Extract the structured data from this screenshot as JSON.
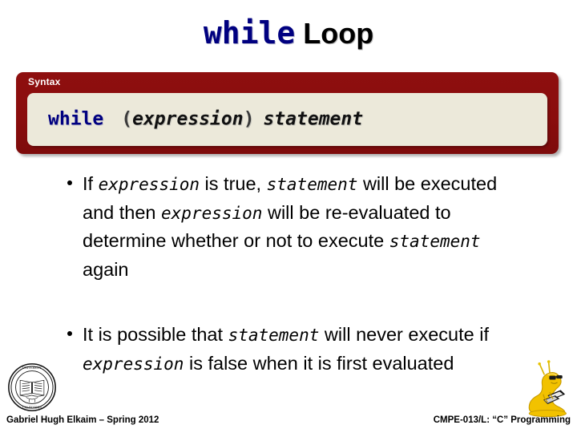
{
  "slide": {
    "title": {
      "keyword": "while",
      "rest": "Loop"
    },
    "syntax_box": {
      "label": "Syntax",
      "code": {
        "keyword": "while",
        "open_paren": "(",
        "placeholder_1": "expression",
        "close_paren": ")",
        "placeholder_2": "statement",
        "full_text": "while (expression) statement"
      },
      "colors": {
        "box_red": "#8e0f0f",
        "code_background": "#ece9da",
        "keyword_blue": "#000080"
      }
    },
    "bullets": [
      {
        "segments": [
          {
            "text": "If ",
            "style": "normal"
          },
          {
            "text": "expression",
            "style": "mono"
          },
          {
            "text": " is true, ",
            "style": "normal"
          },
          {
            "text": "statement",
            "style": "mono"
          },
          {
            "text": " will be executed and then ",
            "style": "normal"
          },
          {
            "text": "expression",
            "style": "mono"
          },
          {
            "text": " will be re-evaluated to determine whether or not to execute ",
            "style": "normal"
          },
          {
            "text": "statement",
            "style": "mono"
          },
          {
            "text": " again",
            "style": "normal"
          }
        ]
      },
      {
        "segments": [
          {
            "text": "It is possible that ",
            "style": "normal"
          },
          {
            "text": "statement",
            "style": "mono"
          },
          {
            "text": " will never execute if ",
            "style": "normal"
          },
          {
            "text": "expression",
            "style": "mono"
          },
          {
            "text": " is false when it is first evaluated",
            "style": "normal"
          }
        ]
      }
    ],
    "footer": {
      "left": "Gabriel Hugh Elkaim – Spring 2012",
      "right": "CMPE-013/L: “C” Programming"
    },
    "logos": {
      "seal": "university-seal-icon",
      "mascot": "banana-slug-mascot-icon",
      "mascot_color": "#f2c200"
    }
  }
}
